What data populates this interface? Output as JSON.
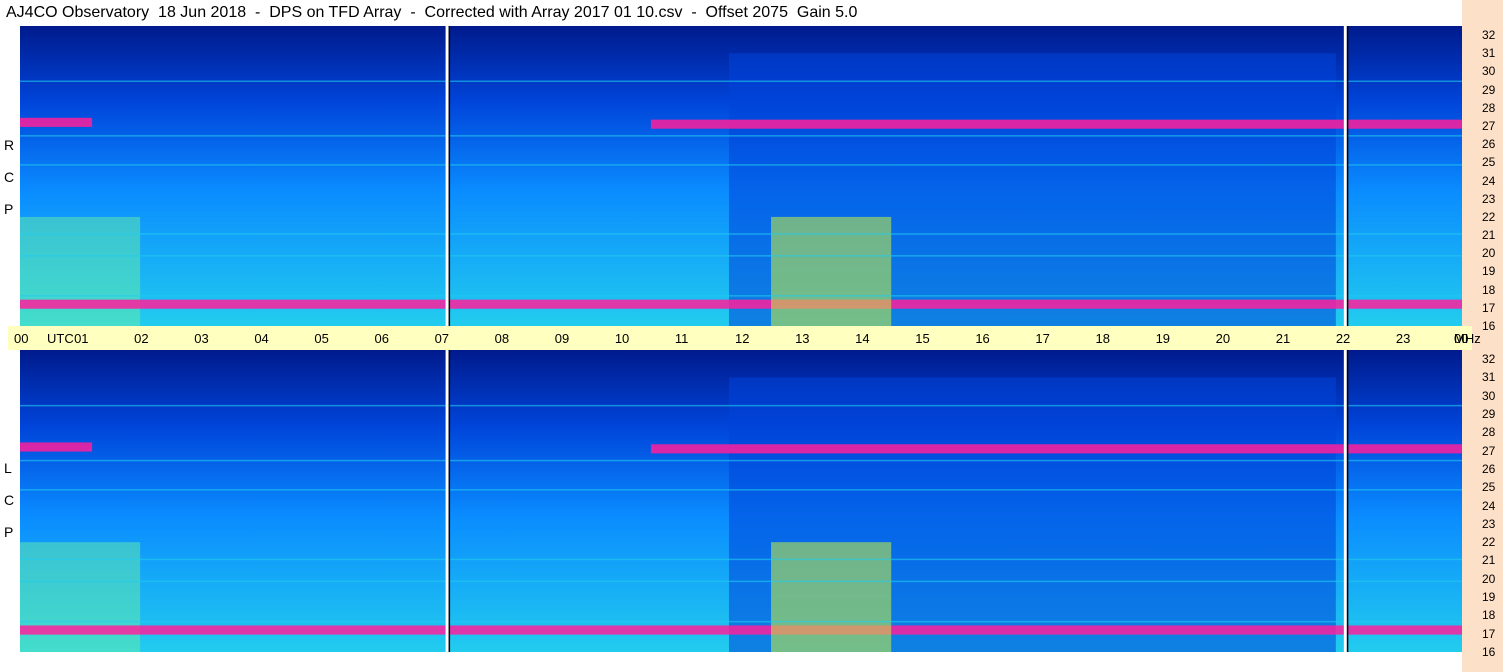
{
  "title": "AJ4CO Observatory  18 Jun 2018  -  DPS on TFD Array  -  Corrected with Array 2017 01 10.csv  -  Offset 2075  Gain 5.0",
  "panels": [
    {
      "id": "rcp",
      "label_letters": [
        "R",
        "C",
        "P"
      ]
    },
    {
      "id": "lcp",
      "label_letters": [
        "L",
        "C",
        "P"
      ]
    }
  ],
  "colors": {
    "axis_band": "#ffffc0",
    "right_strip": "#fde0c8",
    "colormap": [
      "#000033",
      "#001a8c",
      "#0044d9",
      "#0a8cff",
      "#22ccee",
      "#66eeaa",
      "#c8f040",
      "#ff6040",
      "#ff1e9c",
      "#ffffff"
    ]
  },
  "chart_data": {
    "type": "heatmap",
    "title": "AJ4CO Observatory  18 Jun 2018  -  DPS on TFD Array  -  Corrected with Array 2017 01 10.csv  -  Offset 2075  Gain 5.0",
    "xlabel": "UTC",
    "ylabel": "MHz",
    "x_tick_labels": [
      "00",
      "UTC",
      "01",
      "02",
      "03",
      "04",
      "05",
      "06",
      "07",
      "08",
      "09",
      "10",
      "11",
      "12",
      "13",
      "14",
      "15",
      "16",
      "17",
      "18",
      "19",
      "20",
      "21",
      "22",
      "23",
      "00",
      "MHz"
    ],
    "x_ticks": [
      0,
      1,
      2,
      3,
      4,
      5,
      6,
      7,
      8,
      9,
      10,
      11,
      12,
      13,
      14,
      15,
      16,
      17,
      18,
      19,
      20,
      21,
      22,
      23,
      24
    ],
    "xlim": [
      0,
      24
    ],
    "y_tick_labels": [
      "32",
      "31",
      "30",
      "29",
      "28",
      "27",
      "26",
      "25",
      "24",
      "23",
      "22",
      "21",
      "20",
      "19",
      "18",
      "17",
      "16"
    ],
    "ylim": [
      16,
      32.5
    ],
    "panel_labels": [
      "R C P",
      "L C P"
    ],
    "interruptions_utc": [
      7.1,
      22.05
    ],
    "features": [
      {
        "name": "27 MHz band",
        "freq_mhz": 27.2,
        "utc_range": [
          0,
          1.2
        ]
      },
      {
        "name": "27 MHz band",
        "freq_mhz": 27.1,
        "utc_range": [
          10.5,
          24
        ]
      },
      {
        "name": "17 MHz band",
        "freq_mhz": 17.2,
        "utc_range": [
          0,
          24
        ]
      },
      {
        "name": "daytime continuum",
        "freq_mhz_range": [
          16,
          22
        ],
        "utc_range": [
          12.5,
          14.5
        ]
      }
    ]
  }
}
